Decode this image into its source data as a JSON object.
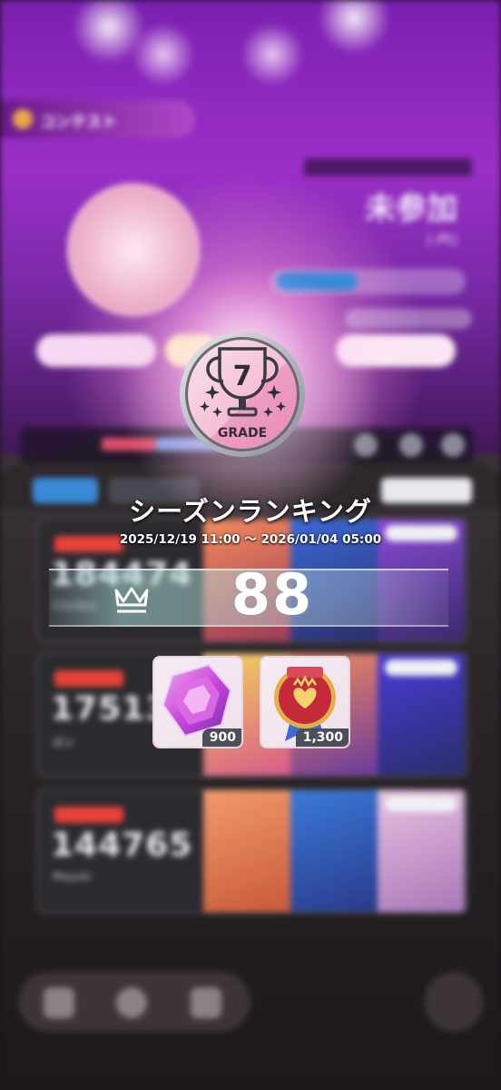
{
  "background": {
    "contest_tab_label": "コンテスト",
    "contest_status": "未参加",
    "contest_points": "(-Pt)",
    "card_scores": [
      "184474",
      "175134",
      "144765"
    ]
  },
  "grade": {
    "number": "7",
    "label": "GRADE"
  },
  "season": {
    "title": "シーズンランキング",
    "period": "2025/12/19 11:00 ～ 2026/01/04 05:00",
    "rank": "88"
  },
  "rewards": [
    {
      "name": "gem-crystal",
      "quantity": "900"
    },
    {
      "name": "emblem-medal",
      "quantity": "1,300"
    }
  ],
  "colors": {
    "badge_pink": "#f2b6cf",
    "badge_ring": "#c9c9cf",
    "accent_purple": "#9b2fc8"
  }
}
